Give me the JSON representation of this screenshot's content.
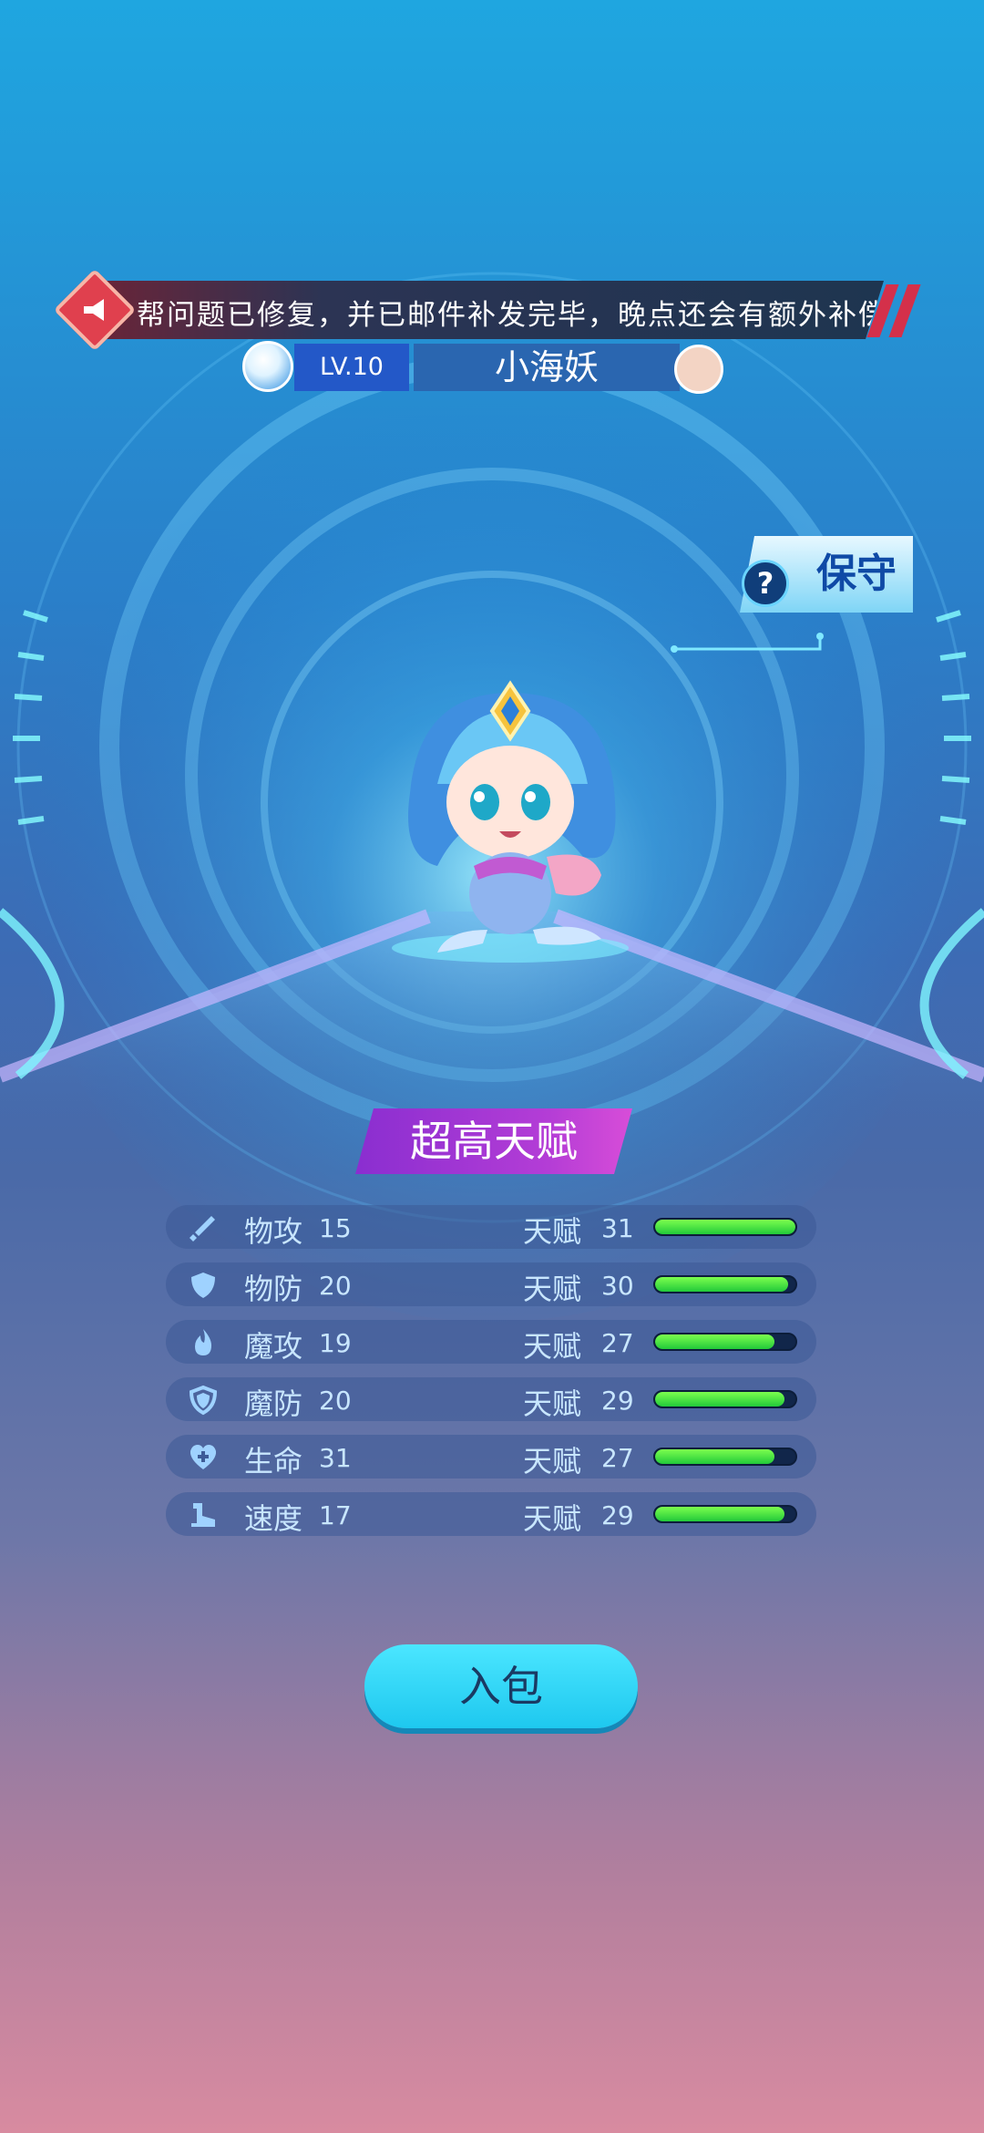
{
  "notice": {
    "text": "帮问题已修复，并已邮件补发完毕，晚点还会有额外补偿"
  },
  "pet": {
    "level": "LV.10",
    "name": "小海妖",
    "element_icon": "water-drop-icon",
    "badge_icon": "pet-face-icon"
  },
  "nature": {
    "label": "保守",
    "help": "?"
  },
  "talent_badge": "超高天赋",
  "stats": [
    {
      "name": "物攻",
      "value": "15",
      "talent_label": "天赋",
      "talent": "31",
      "fill": 1.0,
      "icon": "sword-icon"
    },
    {
      "name": "物防",
      "value": "20",
      "talent_label": "天赋",
      "talent": "30",
      "fill": 0.95,
      "icon": "shield-icon"
    },
    {
      "name": "魔攻",
      "value": "19",
      "talent_label": "天赋",
      "talent": "27",
      "fill": 0.85,
      "icon": "fire-icon"
    },
    {
      "name": "魔防",
      "value": "20",
      "talent_label": "天赋",
      "talent": "29",
      "fill": 0.92,
      "icon": "magic-shield-icon"
    },
    {
      "name": "生命",
      "value": "31",
      "talent_label": "天赋",
      "talent": "27",
      "fill": 0.85,
      "icon": "heart-icon"
    },
    {
      "name": "速度",
      "value": "17",
      "talent_label": "天赋",
      "talent": "29",
      "fill": 0.92,
      "icon": "boot-icon"
    }
  ],
  "button": {
    "label": "入包"
  },
  "colors": {
    "bar_green": "#22c93a",
    "button": "#1ec8ef",
    "talent_purple": "#b43dd6"
  }
}
